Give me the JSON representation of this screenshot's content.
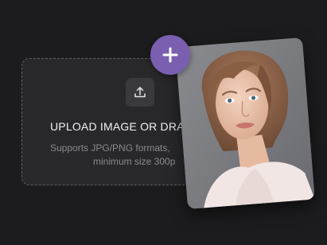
{
  "dropzone": {
    "upload_icon": "upload-icon",
    "title": "UPLOAD IMAGE OR DRA",
    "subtitle_line1": "Supports JPG/PNG formats,",
    "subtitle_line2": "minimum size 300p"
  },
  "preview": {
    "image_description": "portrait photo"
  },
  "add_button": {
    "icon": "plus-icon",
    "color": "#7a5fb0"
  },
  "colors": {
    "background": "#1c1c1e",
    "dropzone_bg": "#28282b",
    "accent": "#7a5fb0"
  }
}
